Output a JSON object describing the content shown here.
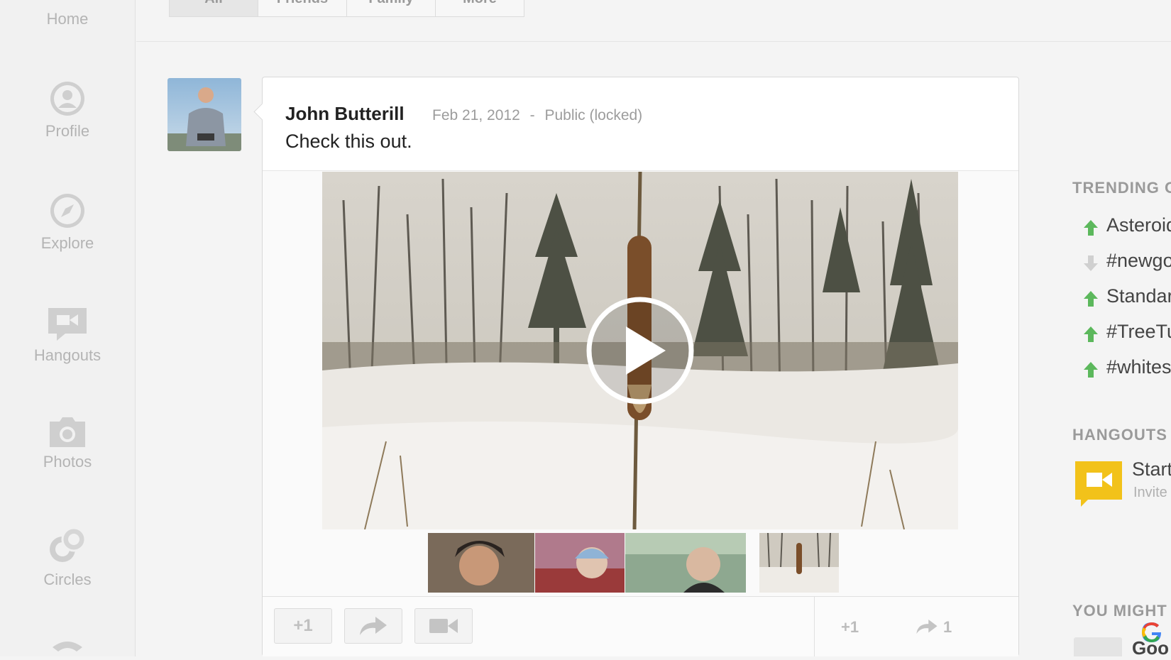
{
  "nav": {
    "items": [
      {
        "label": "Home",
        "icon": "home-icon"
      },
      {
        "label": "Profile",
        "icon": "profile-icon"
      },
      {
        "label": "Explore",
        "icon": "compass-icon"
      },
      {
        "label": "Hangouts",
        "icon": "hangouts-icon"
      },
      {
        "label": "Photos",
        "icon": "camera-icon"
      },
      {
        "label": "Circles",
        "icon": "circles-icon"
      }
    ]
  },
  "tabs": [
    "All",
    "Friends",
    "Family",
    "More"
  ],
  "post": {
    "author": "John Butterill",
    "date": "Feb 21, 2012",
    "separator": "-",
    "visibility": "Public (locked)",
    "text": "Check this out.",
    "actions": {
      "plus_one": "+1",
      "share_icon": "share-arrow-icon",
      "hangout_icon": "video-camera-icon"
    },
    "stats": {
      "plus_one": "+1",
      "shares": "1"
    }
  },
  "right_sidebar": {
    "trending_heading": "TRENDING O",
    "trending": [
      {
        "text": "Asteroid",
        "direction": "up"
      },
      {
        "text": "#newgo",
        "direction": "down"
      },
      {
        "text": "Standar",
        "direction": "up"
      },
      {
        "text": "#TreeTu",
        "direction": "up"
      },
      {
        "text": "#whites",
        "direction": "up"
      }
    ],
    "hangouts_heading": "HANGOUTS",
    "hangout_start": "Start",
    "hangout_invite": "Invite",
    "suggest_heading": "YOU MIGHT",
    "suggest_name": "Goo"
  },
  "colors": {
    "trend_up": "#5cb85c",
    "trend_down": "#d0d0d0",
    "hangout_yellow": "#f2c21a"
  }
}
